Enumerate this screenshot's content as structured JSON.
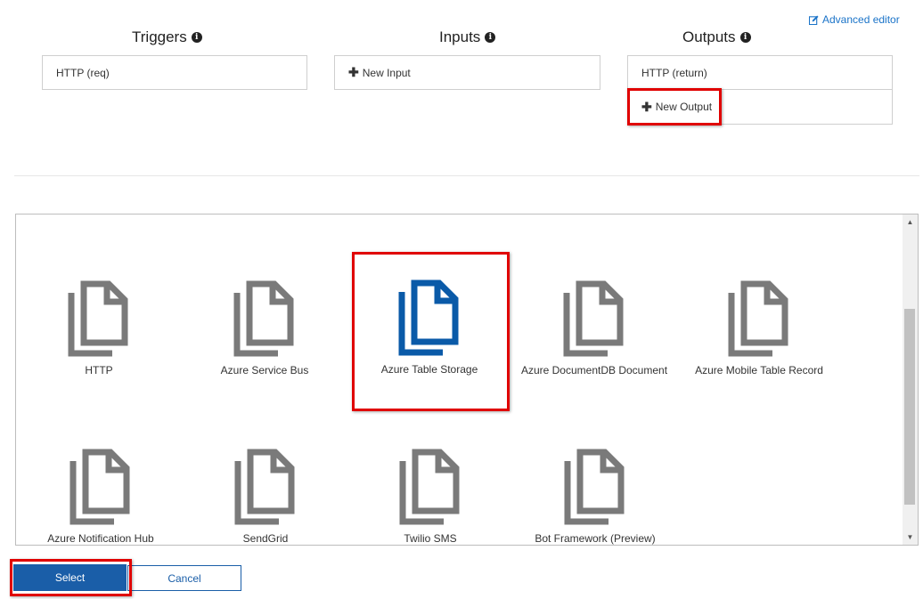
{
  "header": {
    "advanced_editor": "Advanced editor"
  },
  "columns": {
    "triggers": {
      "title": "Triggers",
      "items": [
        "HTTP (req)"
      ]
    },
    "inputs": {
      "title": "Inputs",
      "new_label": "New Input"
    },
    "outputs": {
      "title": "Outputs",
      "items": [
        "HTTP (return)"
      ],
      "new_label": "New Output"
    }
  },
  "templates": [
    {
      "label": "HTTP",
      "selected": false
    },
    {
      "label": "Azure Service Bus",
      "selected": false
    },
    {
      "label": "Azure Table Storage",
      "selected": true
    },
    {
      "label": "Azure DocumentDB Document",
      "selected": false
    },
    {
      "label": "Azure Mobile Table Record",
      "selected": false
    },
    {
      "label": "Azure Notification Hub",
      "selected": false
    },
    {
      "label": "SendGrid",
      "selected": false
    },
    {
      "label": "Twilio SMS",
      "selected": false
    },
    {
      "label": "Bot Framework (Preview)",
      "selected": false
    }
  ],
  "actions": {
    "select": "Select",
    "cancel": "Cancel"
  },
  "colors": {
    "accent": "#1a5ea8",
    "icon_default": "#7a7a7a",
    "icon_selected": "#0a5aa8",
    "highlight": "#e00000"
  }
}
